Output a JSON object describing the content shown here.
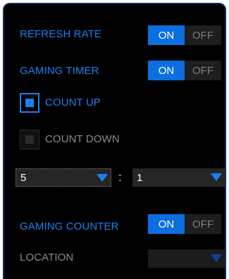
{
  "refresh_rate": {
    "label": "REFRESH RATE",
    "on": "ON",
    "off": "OFF",
    "state": "ON"
  },
  "gaming_timer": {
    "label": "GAMING TIMER",
    "on": "ON",
    "off": "OFF",
    "state": "ON"
  },
  "count_up": {
    "label": "COUNT UP",
    "checked": true
  },
  "count_down": {
    "label": "COUNT DOWN",
    "checked": false
  },
  "timer": {
    "minutes_value": "5",
    "separator": ":",
    "seconds_value": "1"
  },
  "gaming_counter": {
    "label": "GAMING COUNTER",
    "on": "ON",
    "off": "OFF",
    "state": "ON"
  },
  "location": {
    "label": "LOCATION",
    "value": ""
  },
  "colors": {
    "accent": "#1c7ff0",
    "toggle_on": "#0b6fe0",
    "panel_bg": "#000000",
    "border": "#0f2c6b"
  }
}
